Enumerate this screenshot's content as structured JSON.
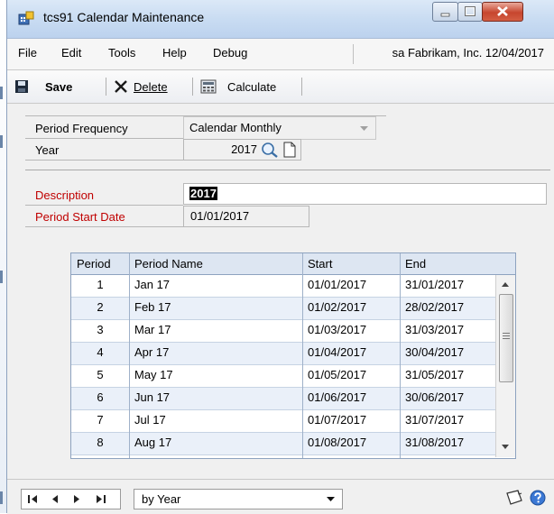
{
  "window": {
    "title": "tcs91 Calendar Maintenance"
  },
  "menu": {
    "items": [
      "File",
      "Edit",
      "Tools",
      "Help",
      "Debug"
    ],
    "context": "sa  Fabrikam, Inc. 12/04/2017"
  },
  "toolbar": {
    "save": "Save",
    "delete": "Delete",
    "calculate": "Calculate"
  },
  "form": {
    "period_frequency_label": "Period Frequency",
    "period_frequency_value": "Calendar Monthly",
    "year_label": "Year",
    "year_value": "2017",
    "description_label": "Description",
    "description_value": "2017",
    "period_start_label": "Period Start Date",
    "period_start_value": "01/01/2017"
  },
  "grid": {
    "headers": [
      "Period",
      "Period Name",
      "Start",
      "End"
    ],
    "rows": [
      [
        "1",
        "Jan 17",
        "01/01/2017",
        "31/01/2017"
      ],
      [
        "2",
        "Feb 17",
        "01/02/2017",
        "28/02/2017"
      ],
      [
        "3",
        "Mar 17",
        "01/03/2017",
        "31/03/2017"
      ],
      [
        "4",
        "Apr 17",
        "01/04/2017",
        "30/04/2017"
      ],
      [
        "5",
        "May 17",
        "01/05/2017",
        "31/05/2017"
      ],
      [
        "6",
        "Jun 17",
        "01/06/2017",
        "30/06/2017"
      ],
      [
        "7",
        "Jul 17",
        "01/07/2017",
        "31/07/2017"
      ],
      [
        "8",
        "Aug 17",
        "01/08/2017",
        "31/08/2017"
      ]
    ]
  },
  "bottom": {
    "sort_value": "by Year"
  },
  "icons": {
    "app": "calendar-app-icon",
    "save": "floppy-disk-icon",
    "delete": "x-delete-icon",
    "calculate": "calculator-icon",
    "lookup": "magnifier-icon",
    "new": "new-document-icon",
    "note": "note-icon",
    "help": "help-icon"
  },
  "colors": {
    "required_label": "#c00000",
    "grid_header": "#dde6f2",
    "grid_alt_row": "#eaf0f9",
    "titlebar": "#c9dcf2"
  }
}
